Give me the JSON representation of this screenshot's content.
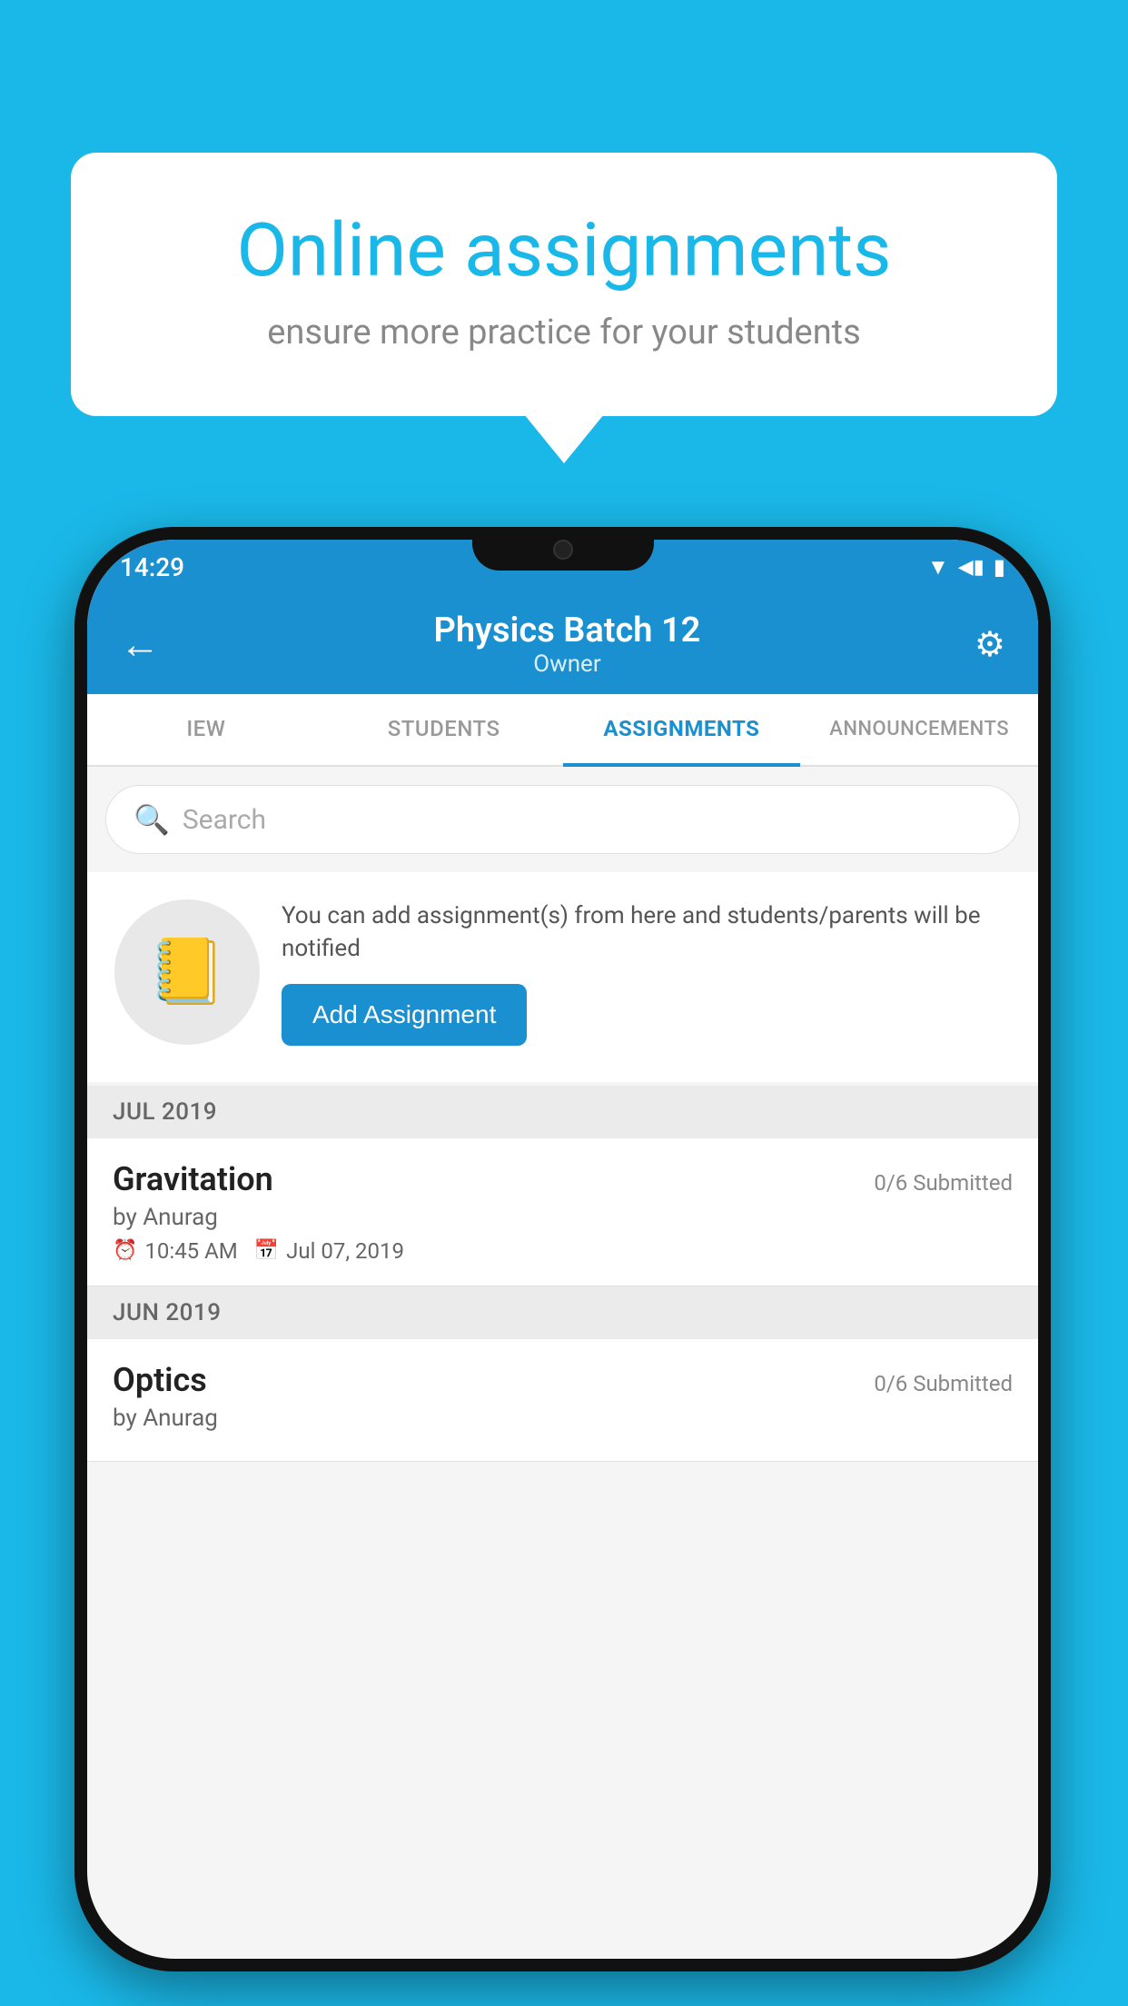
{
  "background": {
    "color": "#1ab8e8"
  },
  "speech_bubble": {
    "title": "Online assignments",
    "subtitle": "ensure more practice for your students"
  },
  "status_bar": {
    "time": "14:29",
    "wifi_icon": "▼",
    "signal_icon": "◀",
    "battery_icon": "▮"
  },
  "app_header": {
    "back_icon": "←",
    "title": "Physics Batch 12",
    "subtitle": "Owner",
    "settings_icon": "⚙"
  },
  "tabs": [
    {
      "label": "IEW",
      "active": false
    },
    {
      "label": "STUDENTS",
      "active": false
    },
    {
      "label": "ASSIGNMENTS",
      "active": true
    },
    {
      "label": "ANNOUNCEMENTS",
      "active": false
    }
  ],
  "search": {
    "placeholder": "Search",
    "icon": "🔍"
  },
  "add_assignment_card": {
    "notebook_emoji": "📓",
    "description": "You can add assignment(s) from here and students/parents will be notified",
    "button_label": "Add Assignment"
  },
  "assignment_sections": [
    {
      "month_label": "JUL 2019",
      "items": [
        {
          "name": "Gravitation",
          "submitted": "0/6 Submitted",
          "by": "by Anurag",
          "time": "10:45 AM",
          "date": "Jul 07, 2019"
        }
      ]
    },
    {
      "month_label": "JUN 2019",
      "items": [
        {
          "name": "Optics",
          "submitted": "0/6 Submitted",
          "by": "by Anurag",
          "time": "",
          "date": ""
        }
      ]
    }
  ]
}
